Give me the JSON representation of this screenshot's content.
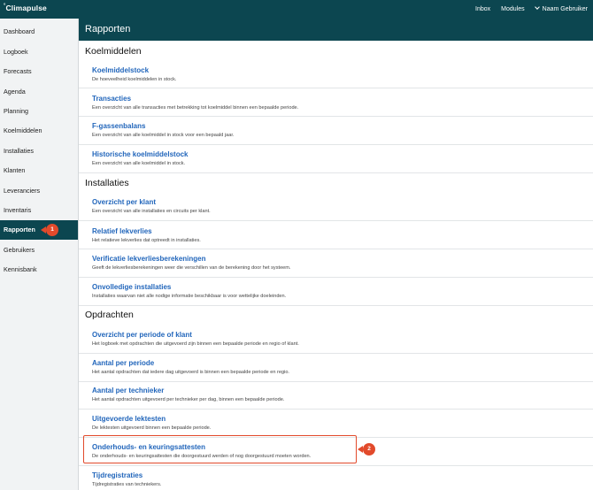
{
  "app": {
    "brand": "Climapulse",
    "nav": [
      "Inbox",
      "Modules",
      "Naam Gebruiker"
    ]
  },
  "sidebar": {
    "items": [
      {
        "label": "Dashboard"
      },
      {
        "label": "Logboek"
      },
      {
        "label": "Forecasts"
      },
      {
        "label": "Agenda"
      },
      {
        "label": "Planning"
      },
      {
        "label": "Koelmiddelen"
      },
      {
        "label": "Installaties"
      },
      {
        "label": "Klanten"
      },
      {
        "label": "Leveranciers"
      },
      {
        "label": "Inventaris"
      },
      {
        "label": "Rapporten",
        "active": true
      },
      {
        "label": "Gebruikers"
      },
      {
        "label": "Kennisbank"
      }
    ]
  },
  "page": {
    "title": "Rapporten"
  },
  "sections": [
    {
      "title": "Koelmiddelen",
      "items": [
        {
          "title": "Koelmiddelstock",
          "desc": "De hoeveelheid koelmiddelen in stock."
        },
        {
          "title": "Transacties",
          "desc": "Een overzicht van alle transacties met betrekking tot koelmiddel binnen een bepaalde periode."
        },
        {
          "title": "F-gassenbalans",
          "desc": "Een overzicht van alle koelmiddel in stock voor een bepaald jaar."
        },
        {
          "title": "Historische koelmiddelstock",
          "desc": "Een overzicht van alle koelmiddel in stock."
        }
      ]
    },
    {
      "title": "Installaties",
      "items": [
        {
          "title": "Overzicht per klant",
          "desc": "Een overzicht van alle installaties en circuits per klant."
        },
        {
          "title": "Relatief lekverlies",
          "desc": "Het relatieve lekverlies dat optreedt in installaties."
        },
        {
          "title": "Verificatie lekverliesberekeningen",
          "desc": "Geeft de lekverliesberekeningen weer die verschillen van de berekening door het systeem."
        },
        {
          "title": "Onvolledige installaties",
          "desc": "Installaties waarvan niet alle nodige informatie beschikbaar is voor wettelijke doeleinden."
        }
      ]
    },
    {
      "title": "Opdrachten",
      "items": [
        {
          "title": "Overzicht per periode of klant",
          "desc": "Het logboek met opdrachten die uitgevoerd zijn binnen een bepaalde periode en regio of klant."
        },
        {
          "title": "Aantal per periode",
          "desc": "Het aantal opdrachten dat iedere dag uitgevoerd is binnen een bepaalde periode en regio."
        },
        {
          "title": "Aantal per technieker",
          "desc": "Het aantal opdrachten uitgevoerd per technieker per dag, binnen een bepaalde periode."
        },
        {
          "title": "Uitgevoerde lektesten",
          "desc": "De lektesten uitgevoerd binnen een bepaalde periode."
        },
        {
          "title": "Onderhouds- en keuringsattesten",
          "desc": "De onderhouds- en keuringsattesten die doorgestuurd werden of nog doorgestuurd moeten worden."
        },
        {
          "title": "Tijdregistraties",
          "desc": "Tijdregistraties van techniekers."
        }
      ]
    }
  ],
  "annotations": [
    "1",
    "2"
  ],
  "colors": {
    "primary": "#0c4650",
    "link": "#2266bb",
    "annotation": "#e24a2b",
    "sidebar_bg": "#f1f3f4"
  }
}
